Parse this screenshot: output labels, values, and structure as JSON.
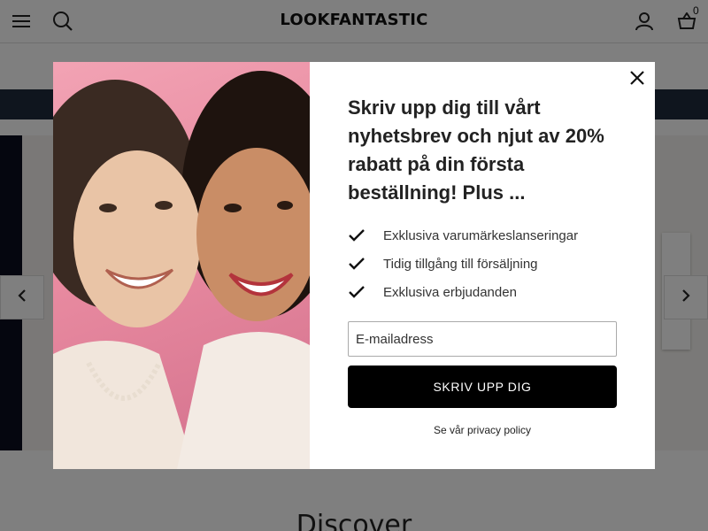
{
  "header": {
    "logo_text": "LOOKFANTASTIC",
    "menu_icon": "hamburger-icon",
    "search_icon": "search-icon",
    "account_icon": "account-icon",
    "cart_icon": "basket-icon",
    "cart_count": "0"
  },
  "page": {
    "section_heading": "Discover",
    "promo_bar_color": "#1f2b3c"
  },
  "carousel": {
    "prev_icon": "chevron-left-icon",
    "next_icon": "chevron-right-icon"
  },
  "modal": {
    "title": "Skriv upp dig till vårt nyhetsbrev och njut av 20% rabatt på din första beställning! Plus ...",
    "benefits": [
      "Exklusiva varumärkeslanseringar",
      "Tidig tillgång till försäljning",
      "Exklusiva erbjudanden"
    ],
    "email_placeholder": "E-mailadress",
    "submit_label": "SKRIV UPP DIG",
    "privacy_link": "Se vår privacy policy",
    "close_icon": "close-icon",
    "check_icon": "checkmark-icon"
  },
  "colors": {
    "button_bg": "#000000",
    "overlay": "rgba(0,0,0,0.5)"
  }
}
